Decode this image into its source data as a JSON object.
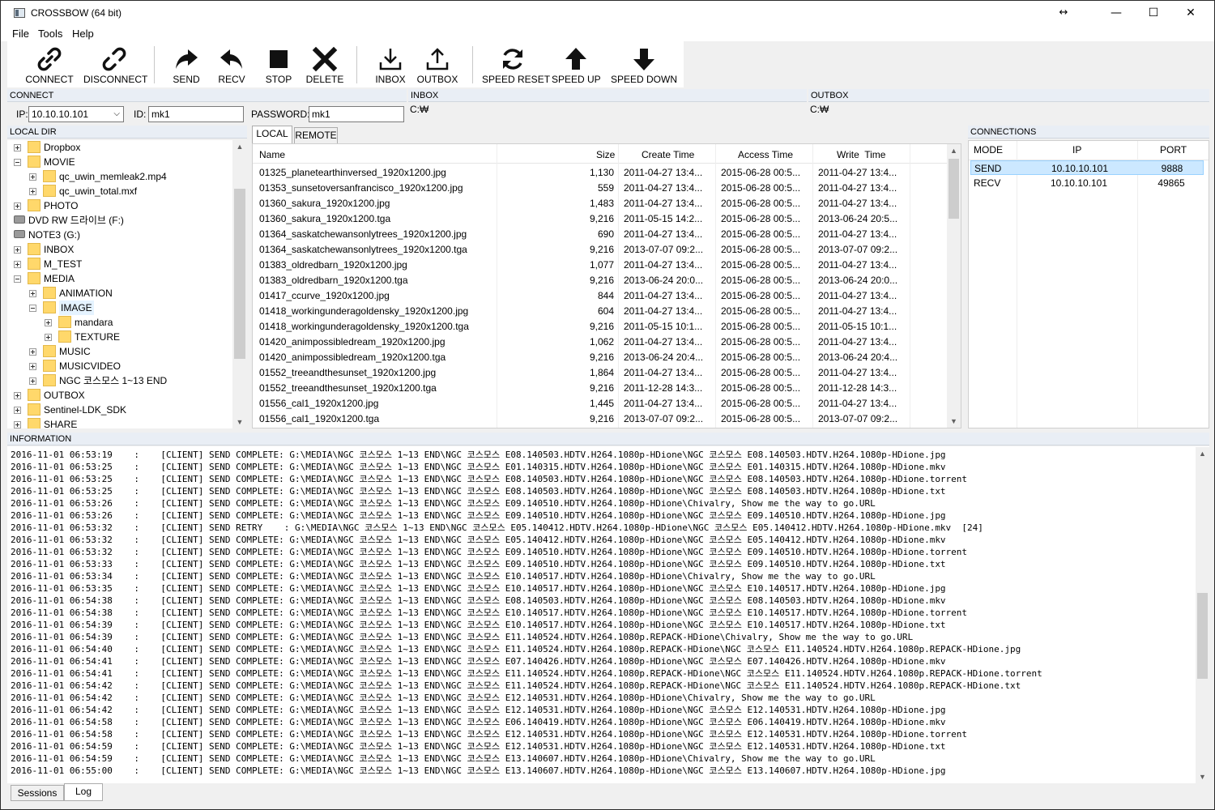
{
  "window": {
    "title": "CROSSBOW (64 bit)",
    "resize_glyph": "↔",
    "min_glyph": "—",
    "max_glyph": "☐",
    "close_glyph": "✕"
  },
  "menu": [
    "File",
    "Tools",
    "Help"
  ],
  "toolbar": {
    "connect": "CONNECT",
    "disconnect": "DISCONNECT",
    "send": "SEND",
    "recv": "RECV",
    "stop": "STOP",
    "delete": "DELETE",
    "inbox": "INBOX",
    "outbox": "OUTBOX",
    "speed_reset": "SPEED RESET",
    "speed_up": "SPEED UP",
    "speed_down": "SPEED DOWN"
  },
  "connect": {
    "header": "CONNECT",
    "ip_label": "IP:",
    "ip_value": "10.10.10.101",
    "id_label": "ID:",
    "id_value": "mk1",
    "password_label": "PASSWORD:",
    "password_value": "mk1"
  },
  "inbox": {
    "header": "INBOX",
    "path": "C:₩"
  },
  "outbox": {
    "header": "OUTBOX",
    "path": "C:₩"
  },
  "local_dir": {
    "header": "LOCAL DIR",
    "nodes": [
      {
        "label": "Dropbox",
        "level": 0,
        "kind": "folder",
        "expander": "plus"
      },
      {
        "label": "MOVIE",
        "level": 0,
        "kind": "folder",
        "expander": "minus"
      },
      {
        "label": "qc_uwin_memleak2.mp4",
        "level": 1,
        "kind": "folder",
        "expander": "plus"
      },
      {
        "label": "qc_uwin_total.mxf",
        "level": 1,
        "kind": "folder",
        "expander": "plus"
      },
      {
        "label": "PHOTO",
        "level": 0,
        "kind": "folder",
        "expander": "plus"
      },
      {
        "label": "DVD RW 드라이브 (F:)",
        "level": -1,
        "kind": "dvd",
        "expander": "none"
      },
      {
        "label": "NOTE3 (G:)",
        "level": -1,
        "kind": "drive",
        "expander": "none"
      },
      {
        "label": "INBOX",
        "level": 0,
        "kind": "folder",
        "expander": "plus"
      },
      {
        "label": "M_TEST",
        "level": 0,
        "kind": "folder",
        "expander": "plus"
      },
      {
        "label": "MEDIA",
        "level": 0,
        "kind": "folder",
        "expander": "minus"
      },
      {
        "label": "ANIMATION",
        "level": 1,
        "kind": "folder",
        "expander": "plus"
      },
      {
        "label": "IMAGE",
        "level": 1,
        "kind": "folder",
        "expander": "minus"
      },
      {
        "label": "mandara",
        "level": 2,
        "kind": "folder",
        "expander": "plus"
      },
      {
        "label": "TEXTURE",
        "level": 2,
        "kind": "folder",
        "expander": "plus"
      },
      {
        "label": "MUSIC",
        "level": 1,
        "kind": "folder",
        "expander": "plus"
      },
      {
        "label": "MUSICVIDEO",
        "level": 1,
        "kind": "folder",
        "expander": "plus"
      },
      {
        "label": "NGC 코스모스 1~13 END",
        "level": 1,
        "kind": "folder",
        "expander": "plus"
      },
      {
        "label": "OUTBOX",
        "level": 0,
        "kind": "folder",
        "expander": "plus"
      },
      {
        "label": "Sentinel-LDK_SDK",
        "level": 0,
        "kind": "folder",
        "expander": "plus"
      },
      {
        "label": "SHARE",
        "level": 0,
        "kind": "folder",
        "expander": "plus"
      }
    ]
  },
  "file_tabs": [
    "LOCAL",
    "REMOTE"
  ],
  "files": {
    "columns": [
      "Name",
      "Size",
      "Create Time",
      "Access Time",
      "Write  Time"
    ],
    "rows": [
      [
        "01325_planetearthinversed_1920x1200.jpg",
        "1,130",
        "2011-04-27 13:4...",
        "2015-06-28 00:5...",
        "2011-04-27 13:4..."
      ],
      [
        "01353_sunsetoversanfrancisco_1920x1200.jpg",
        "559",
        "2011-04-27 13:4...",
        "2015-06-28 00:5...",
        "2011-04-27 13:4..."
      ],
      [
        "01360_sakura_1920x1200.jpg",
        "1,483",
        "2011-04-27 13:4...",
        "2015-06-28 00:5...",
        "2011-04-27 13:4..."
      ],
      [
        "01360_sakura_1920x1200.tga",
        "9,216",
        "2011-05-15 14:2...",
        "2015-06-28 00:5...",
        "2013-06-24 20:5..."
      ],
      [
        "01364_saskatchewansonlytrees_1920x1200.jpg",
        "690",
        "2011-04-27 13:4...",
        "2015-06-28 00:5...",
        "2011-04-27 13:4..."
      ],
      [
        "01364_saskatchewansonlytrees_1920x1200.tga",
        "9,216",
        "2013-07-07 09:2...",
        "2015-06-28 00:5...",
        "2013-07-07 09:2..."
      ],
      [
        "01383_oldredbarn_1920x1200.jpg",
        "1,077",
        "2011-04-27 13:4...",
        "2015-06-28 00:5...",
        "2011-04-27 13:4..."
      ],
      [
        "01383_oldredbarn_1920x1200.tga",
        "9,216",
        "2013-06-24 20:0...",
        "2015-06-28 00:5...",
        "2013-06-24 20:0..."
      ],
      [
        "01417_ccurve_1920x1200.jpg",
        "844",
        "2011-04-27 13:4...",
        "2015-06-28 00:5...",
        "2011-04-27 13:4..."
      ],
      [
        "01418_workingunderagoldensky_1920x1200.jpg",
        "604",
        "2011-04-27 13:4...",
        "2015-06-28 00:5...",
        "2011-04-27 13:4..."
      ],
      [
        "01418_workingunderagoldensky_1920x1200.tga",
        "9,216",
        "2011-05-15 10:1...",
        "2015-06-28 00:5...",
        "2011-05-15 10:1..."
      ],
      [
        "01420_animpossibledream_1920x1200.jpg",
        "1,062",
        "2011-04-27 13:4...",
        "2015-06-28 00:5...",
        "2011-04-27 13:4..."
      ],
      [
        "01420_animpossibledream_1920x1200.tga",
        "9,216",
        "2013-06-24 20:4...",
        "2015-06-28 00:5...",
        "2013-06-24 20:4..."
      ],
      [
        "01552_treeandthesunset_1920x1200.jpg",
        "1,864",
        "2011-04-27 13:4...",
        "2015-06-28 00:5...",
        "2011-04-27 13:4..."
      ],
      [
        "01552_treeandthesunset_1920x1200.tga",
        "9,216",
        "2011-12-28 14:3...",
        "2015-06-28 00:5...",
        "2011-12-28 14:3..."
      ],
      [
        "01556_cal1_1920x1200.jpg",
        "1,445",
        "2011-04-27 13:4...",
        "2015-06-28 00:5...",
        "2011-04-27 13:4..."
      ],
      [
        "01556_cal1_1920x1200.tga",
        "9,216",
        "2013-07-07 09:2...",
        "2015-06-28 00:5...",
        "2013-07-07 09:2..."
      ]
    ]
  },
  "connections": {
    "header": "CONNECTIONS",
    "columns": [
      "MODE",
      "IP",
      "PORT"
    ],
    "rows": [
      [
        "SEND",
        "10.10.10.101",
        "9888"
      ],
      [
        "RECV",
        "10.10.10.101",
        "49865"
      ]
    ]
  },
  "information": {
    "header": "INFORMATION",
    "lines": [
      "2016-11-01 06:53:19    :    [CLIENT] SEND COMPLETE: G:\\MEDIA\\NGC 코스모스 1~13 END\\NGC 코스모스 E08.140503.HDTV.H264.1080p-HDione\\NGC 코스모스 E08.140503.HDTV.H264.1080p-HDione.jpg",
      "2016-11-01 06:53:25    :    [CLIENT] SEND COMPLETE: G:\\MEDIA\\NGC 코스모스 1~13 END\\NGC 코스모스 E01.140315.HDTV.H264.1080p-HDione\\NGC 코스모스 E01.140315.HDTV.H264.1080p-HDione.mkv",
      "2016-11-01 06:53:25    :    [CLIENT] SEND COMPLETE: G:\\MEDIA\\NGC 코스모스 1~13 END\\NGC 코스모스 E08.140503.HDTV.H264.1080p-HDione\\NGC 코스모스 E08.140503.HDTV.H264.1080p-HDione.torrent",
      "2016-11-01 06:53:25    :    [CLIENT] SEND COMPLETE: G:\\MEDIA\\NGC 코스모스 1~13 END\\NGC 코스모스 E08.140503.HDTV.H264.1080p-HDione\\NGC 코스모스 E08.140503.HDTV.H264.1080p-HDione.txt",
      "2016-11-01 06:53:26    :    [CLIENT] SEND COMPLETE: G:\\MEDIA\\NGC 코스모스 1~13 END\\NGC 코스모스 E09.140510.HDTV.H264.1080p-HDione\\Chivalry, Show me the way to go.URL",
      "2016-11-01 06:53:26    :    [CLIENT] SEND COMPLETE: G:\\MEDIA\\NGC 코스모스 1~13 END\\NGC 코스모스 E09.140510.HDTV.H264.1080p-HDione\\NGC 코스모스 E09.140510.HDTV.H264.1080p-HDione.jpg",
      "2016-11-01 06:53:32    :    [CLIENT] SEND RETRY    : G:\\MEDIA\\NGC 코스모스 1~13 END\\NGC 코스모스 E05.140412.HDTV.H264.1080p-HDione\\NGC 코스모스 E05.140412.HDTV.H264.1080p-HDione.mkv  [24]",
      "2016-11-01 06:53:32    :    [CLIENT] SEND COMPLETE: G:\\MEDIA\\NGC 코스모스 1~13 END\\NGC 코스모스 E05.140412.HDTV.H264.1080p-HDione\\NGC 코스모스 E05.140412.HDTV.H264.1080p-HDione.mkv",
      "2016-11-01 06:53:32    :    [CLIENT] SEND COMPLETE: G:\\MEDIA\\NGC 코스모스 1~13 END\\NGC 코스모스 E09.140510.HDTV.H264.1080p-HDione\\NGC 코스모스 E09.140510.HDTV.H264.1080p-HDione.torrent",
      "2016-11-01 06:53:33    :    [CLIENT] SEND COMPLETE: G:\\MEDIA\\NGC 코스모스 1~13 END\\NGC 코스모스 E09.140510.HDTV.H264.1080p-HDione\\NGC 코스모스 E09.140510.HDTV.H264.1080p-HDione.txt",
      "2016-11-01 06:53:34    :    [CLIENT] SEND COMPLETE: G:\\MEDIA\\NGC 코스모스 1~13 END\\NGC 코스모스 E10.140517.HDTV.H264.1080p-HDione\\Chivalry, Show me the way to go.URL",
      "2016-11-01 06:53:35    :    [CLIENT] SEND COMPLETE: G:\\MEDIA\\NGC 코스모스 1~13 END\\NGC 코스모스 E10.140517.HDTV.H264.1080p-HDione\\NGC 코스모스 E10.140517.HDTV.H264.1080p-HDione.jpg",
      "2016-11-01 06:54:38    :    [CLIENT] SEND COMPLETE: G:\\MEDIA\\NGC 코스모스 1~13 END\\NGC 코스모스 E08.140503.HDTV.H264.1080p-HDione\\NGC 코스모스 E08.140503.HDTV.H264.1080p-HDione.mkv",
      "2016-11-01 06:54:38    :    [CLIENT] SEND COMPLETE: G:\\MEDIA\\NGC 코스모스 1~13 END\\NGC 코스모스 E10.140517.HDTV.H264.1080p-HDione\\NGC 코스모스 E10.140517.HDTV.H264.1080p-HDione.torrent",
      "2016-11-01 06:54:39    :    [CLIENT] SEND COMPLETE: G:\\MEDIA\\NGC 코스모스 1~13 END\\NGC 코스모스 E10.140517.HDTV.H264.1080p-HDione\\NGC 코스모스 E10.140517.HDTV.H264.1080p-HDione.txt",
      "2016-11-01 06:54:39    :    [CLIENT] SEND COMPLETE: G:\\MEDIA\\NGC 코스모스 1~13 END\\NGC 코스모스 E11.140524.HDTV.H264.1080p.REPACK-HDione\\Chivalry, Show me the way to go.URL",
      "2016-11-01 06:54:40    :    [CLIENT] SEND COMPLETE: G:\\MEDIA\\NGC 코스모스 1~13 END\\NGC 코스모스 E11.140524.HDTV.H264.1080p.REPACK-HDione\\NGC 코스모스 E11.140524.HDTV.H264.1080p.REPACK-HDione.jpg",
      "2016-11-01 06:54:41    :    [CLIENT] SEND COMPLETE: G:\\MEDIA\\NGC 코스모스 1~13 END\\NGC 코스모스 E07.140426.HDTV.H264.1080p-HDione\\NGC 코스모스 E07.140426.HDTV.H264.1080p-HDione.mkv",
      "2016-11-01 06:54:41    :    [CLIENT] SEND COMPLETE: G:\\MEDIA\\NGC 코스모스 1~13 END\\NGC 코스모스 E11.140524.HDTV.H264.1080p.REPACK-HDione\\NGC 코스모스 E11.140524.HDTV.H264.1080p.REPACK-HDione.torrent",
      "2016-11-01 06:54:42    :    [CLIENT] SEND COMPLETE: G:\\MEDIA\\NGC 코스모스 1~13 END\\NGC 코스모스 E11.140524.HDTV.H264.1080p.REPACK-HDione\\NGC 코스모스 E11.140524.HDTV.H264.1080p.REPACK-HDione.txt",
      "2016-11-01 06:54:42    :    [CLIENT] SEND COMPLETE: G:\\MEDIA\\NGC 코스모스 1~13 END\\NGC 코스모스 E12.140531.HDTV.H264.1080p-HDione\\Chivalry, Show me the way to go.URL",
      "2016-11-01 06:54:42    :    [CLIENT] SEND COMPLETE: G:\\MEDIA\\NGC 코스모스 1~13 END\\NGC 코스모스 E12.140531.HDTV.H264.1080p-HDione\\NGC 코스모스 E12.140531.HDTV.H264.1080p-HDione.jpg",
      "2016-11-01 06:54:58    :    [CLIENT] SEND COMPLETE: G:\\MEDIA\\NGC 코스모스 1~13 END\\NGC 코스모스 E06.140419.HDTV.H264.1080p-HDione\\NGC 코스모스 E06.140419.HDTV.H264.1080p-HDione.mkv",
      "2016-11-01 06:54:58    :    [CLIENT] SEND COMPLETE: G:\\MEDIA\\NGC 코스모스 1~13 END\\NGC 코스모스 E12.140531.HDTV.H264.1080p-HDione\\NGC 코스모스 E12.140531.HDTV.H264.1080p-HDione.torrent",
      "2016-11-01 06:54:59    :    [CLIENT] SEND COMPLETE: G:\\MEDIA\\NGC 코스모스 1~13 END\\NGC 코스모스 E12.140531.HDTV.H264.1080p-HDione\\NGC 코스모스 E12.140531.HDTV.H264.1080p-HDione.txt",
      "2016-11-01 06:54:59    :    [CLIENT] SEND COMPLETE: G:\\MEDIA\\NGC 코스모스 1~13 END\\NGC 코스모스 E13.140607.HDTV.H264.1080p-HDione\\Chivalry, Show me the way to go.URL",
      "2016-11-01 06:55:00    :    [CLIENT] SEND COMPLETE: G:\\MEDIA\\NGC 코스모스 1~13 END\\NGC 코스모스 E13.140607.HDTV.H264.1080p-HDione\\NGC 코스모스 E13.140607.HDTV.H264.1080p-HDione.jpg"
    ]
  },
  "bottom_tabs": [
    "Sessions",
    "Log"
  ],
  "colors": {
    "folder": "#ffd86b",
    "selected_row": "#cce8ff",
    "section_header": "#e9eef5"
  }
}
